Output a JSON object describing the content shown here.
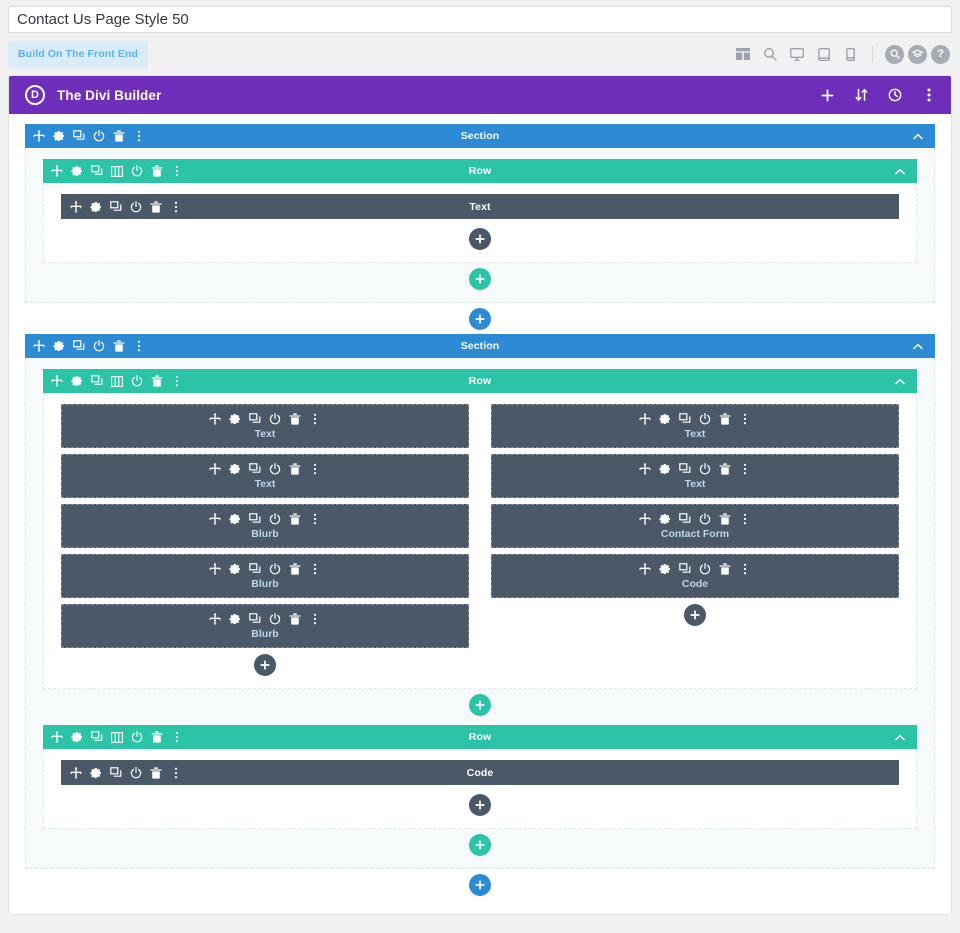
{
  "page": {
    "title_value": "Contact Us Page Style 50",
    "title_placeholder": "Add title"
  },
  "toolbar": {
    "front_end_button": "Build On The Front End",
    "icons": [
      {
        "name": "wireframe-view-icon",
        "glyph": "wireframe"
      },
      {
        "name": "zoom-out-view-icon",
        "glyph": "zoom"
      },
      {
        "name": "desktop-view-icon",
        "glyph": "desktop"
      },
      {
        "name": "tablet-view-icon",
        "glyph": "tablet"
      },
      {
        "name": "phone-view-icon",
        "glyph": "phone"
      }
    ],
    "round_icons": [
      {
        "name": "search-icon",
        "glyph": "⌕"
      },
      {
        "name": "layers-icon",
        "glyph": "≡"
      },
      {
        "name": "help-icon",
        "glyph": "?"
      }
    ]
  },
  "builder": {
    "logo_letter": "D",
    "title": "The Divi Builder",
    "actions": [
      {
        "name": "add-from-library-button",
        "glyph": "+"
      },
      {
        "name": "reorder-button",
        "glyph": "⇅"
      },
      {
        "name": "history-button",
        "glyph": "◴"
      },
      {
        "name": "more-options-button",
        "glyph": "⋮"
      }
    ]
  },
  "labels": {
    "section": "Section",
    "row": "Row",
    "module_text": "Text",
    "module_blurb": "Blurb",
    "module_code": "Code",
    "module_contact_form": "Contact Form"
  },
  "icon_sets": {
    "section": [
      "move-icon",
      "settings-icon",
      "duplicate-icon",
      "disable-icon",
      "delete-icon",
      "more-icon"
    ],
    "row": [
      "move-icon",
      "settings-icon",
      "duplicate-icon",
      "columns-icon",
      "disable-icon",
      "delete-icon",
      "more-icon"
    ],
    "module": [
      "move-icon",
      "settings-icon",
      "duplicate-icon",
      "disable-icon",
      "delete-icon",
      "more-icon"
    ]
  },
  "add_buttons": {
    "module": "+",
    "row": "+",
    "section": "+"
  },
  "colors": {
    "section": "#2d8ad4",
    "row": "#2bc4a6",
    "module": "#4b5868",
    "builder_bar": "#6f2eb9",
    "module_label": "#bcd6ec",
    "front_end_btn_bg": "#d9ecf7",
    "front_end_btn_text": "#5ab3e8"
  },
  "structure": [
    {
      "type": "section",
      "rows": [
        {
          "type": "row",
          "columns": [
            {
              "modules": [
                {
                  "label": "Text",
                  "style": "bar"
                }
              ]
            }
          ]
        }
      ]
    },
    {
      "type": "section",
      "rows": [
        {
          "type": "row",
          "columns": [
            {
              "modules": [
                {
                  "label": "Text",
                  "style": "block"
                },
                {
                  "label": "Text",
                  "style": "block"
                },
                {
                  "label": "Blurb",
                  "style": "block"
                },
                {
                  "label": "Blurb",
                  "style": "block"
                },
                {
                  "label": "Blurb",
                  "style": "block"
                }
              ]
            },
            {
              "modules": [
                {
                  "label": "Text",
                  "style": "block"
                },
                {
                  "label": "Text",
                  "style": "block"
                },
                {
                  "label": "Contact Form",
                  "style": "block"
                },
                {
                  "label": "Code",
                  "style": "block"
                }
              ]
            }
          ]
        },
        {
          "type": "row",
          "columns": [
            {
              "modules": [
                {
                  "label": "Code",
                  "style": "bar"
                }
              ]
            }
          ]
        }
      ]
    }
  ]
}
